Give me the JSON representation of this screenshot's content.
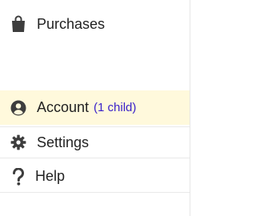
{
  "menu": {
    "items": [
      {
        "label": "Purchases",
        "icon": "shopping-bag-icon"
      },
      {
        "label": "Account",
        "sub": "(1 child)",
        "icon": "user-circle-icon",
        "active": true
      },
      {
        "label": "Settings",
        "icon": "gear-icon"
      },
      {
        "label": "Help",
        "icon": "question-icon"
      }
    ]
  },
  "colors": {
    "active_bg": "#fff9dc",
    "sub_text": "#3a22c9",
    "icon": "#3d3d3d"
  }
}
